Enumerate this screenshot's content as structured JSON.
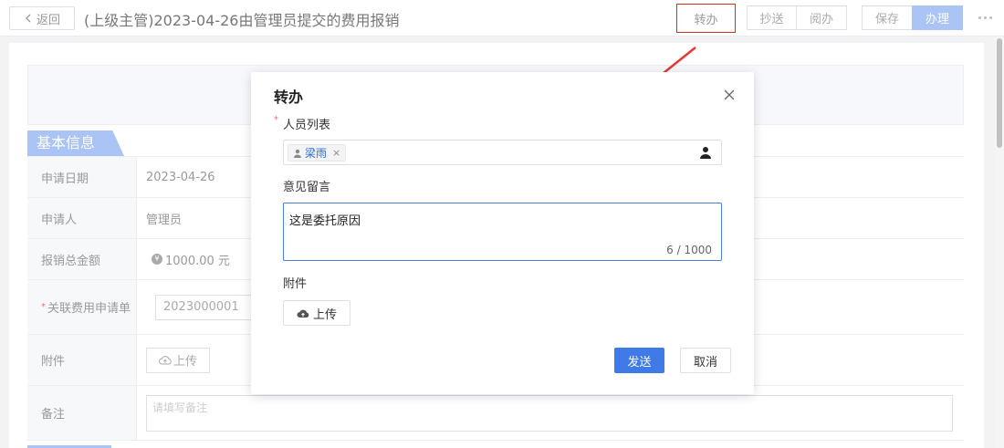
{
  "header": {
    "back_label": "返回",
    "title": "(上级主管)2023-04-26由管理员提交的费用报销",
    "buttons": {
      "transfer": "转办",
      "cc": "抄送",
      "read": "阅办",
      "save": "保存",
      "handle": "办理"
    }
  },
  "form": {
    "section_title": "基本信息",
    "rows": [
      {
        "label": "申请日期",
        "value": "2023-04-26"
      },
      {
        "label": "申请人",
        "value": "管理员"
      },
      {
        "label": "报销总金额",
        "value": "1000.00 元"
      },
      {
        "label": "关联费用申请单",
        "value": "2023000001"
      },
      {
        "label": "附件",
        "value": "上传"
      },
      {
        "label": "备注",
        "placeholder": "请填写备注"
      }
    ]
  },
  "modal": {
    "title": "转办",
    "person_label": "人员列表",
    "selected_person": "梁雨",
    "comment_label": "意见留言",
    "comment_value": "这是委托原因",
    "char_count": "6 / 1000",
    "attachment_label": "附件",
    "upload_label": "上传",
    "send_label": "发送",
    "cancel_label": "取消"
  },
  "colors": {
    "primary": "#3f7ae6",
    "section": "#a9c4f5",
    "highlight": "#d32f2f"
  }
}
